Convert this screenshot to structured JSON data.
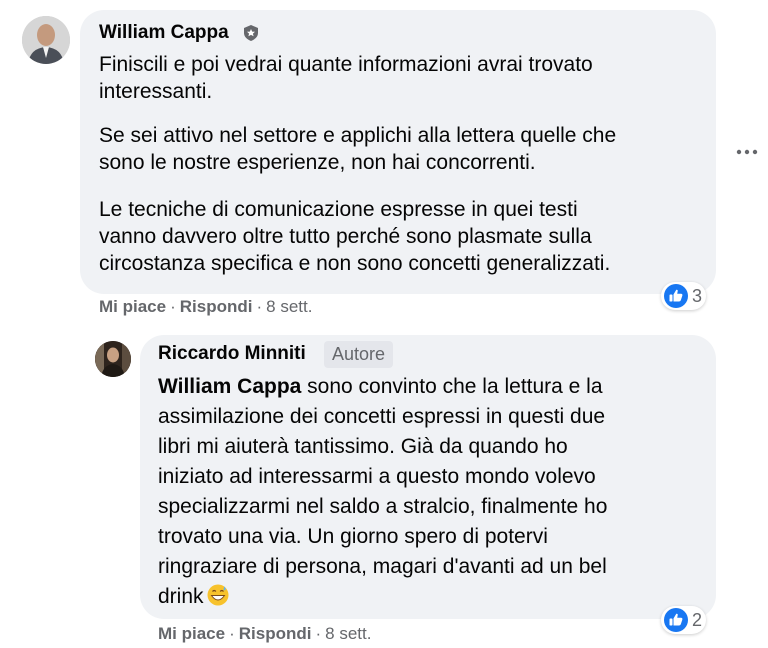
{
  "comment": {
    "author": "William Cappa",
    "paragraphs": [
      [
        "Finiscili e poi vedrai quante informazioni avrai trovato",
        "interessanti."
      ],
      [
        "Se sei attivo nel settore e applichi alla lettera quelle che",
        "sono le nostre esperienze, non hai concorrenti."
      ],
      [
        "Le tecniche di comunicazione espresse in quei testi",
        "vanno davvero oltre tutto perché sono plasmate sulla",
        "circostanza specifica e non sono concetti generalizzati."
      ]
    ],
    "like_label": "Mi piace",
    "reply_label": "Rispondi",
    "separator": "·",
    "time": "8 sett.",
    "reaction_count": "3"
  },
  "reply": {
    "author": "Riccardo Minniti",
    "badge": "Autore",
    "mention": "William Cappa",
    "lines": [
      " sono convinto che la lettura e la",
      "assimilazione dei concetti espressi in questi due",
      "libri mi aiuterà tantissimo. Già da quando ho",
      "iniziato ad interessarmi a questo mondo volevo",
      "specializzarmi nel saldo a stralcio, finalmente ho",
      "trovato una via. Un giorno spero di potervi",
      "ringraziare di persona, magari d'avanti ad un bel",
      "drink"
    ],
    "emoji_icon": "grinning-sweat-emoji",
    "like_label": "Mi piace",
    "reply_label": "Rispondi",
    "separator": "·",
    "time": "8 sett.",
    "reaction_count": "2"
  },
  "icons": {
    "reaction": "like-icon",
    "verified": "shield-icon",
    "more": "more-options-icon"
  },
  "colors": {
    "bubble": "#f0f2f5",
    "secondary_text": "#65676b",
    "like_blue": "#1877f2"
  }
}
